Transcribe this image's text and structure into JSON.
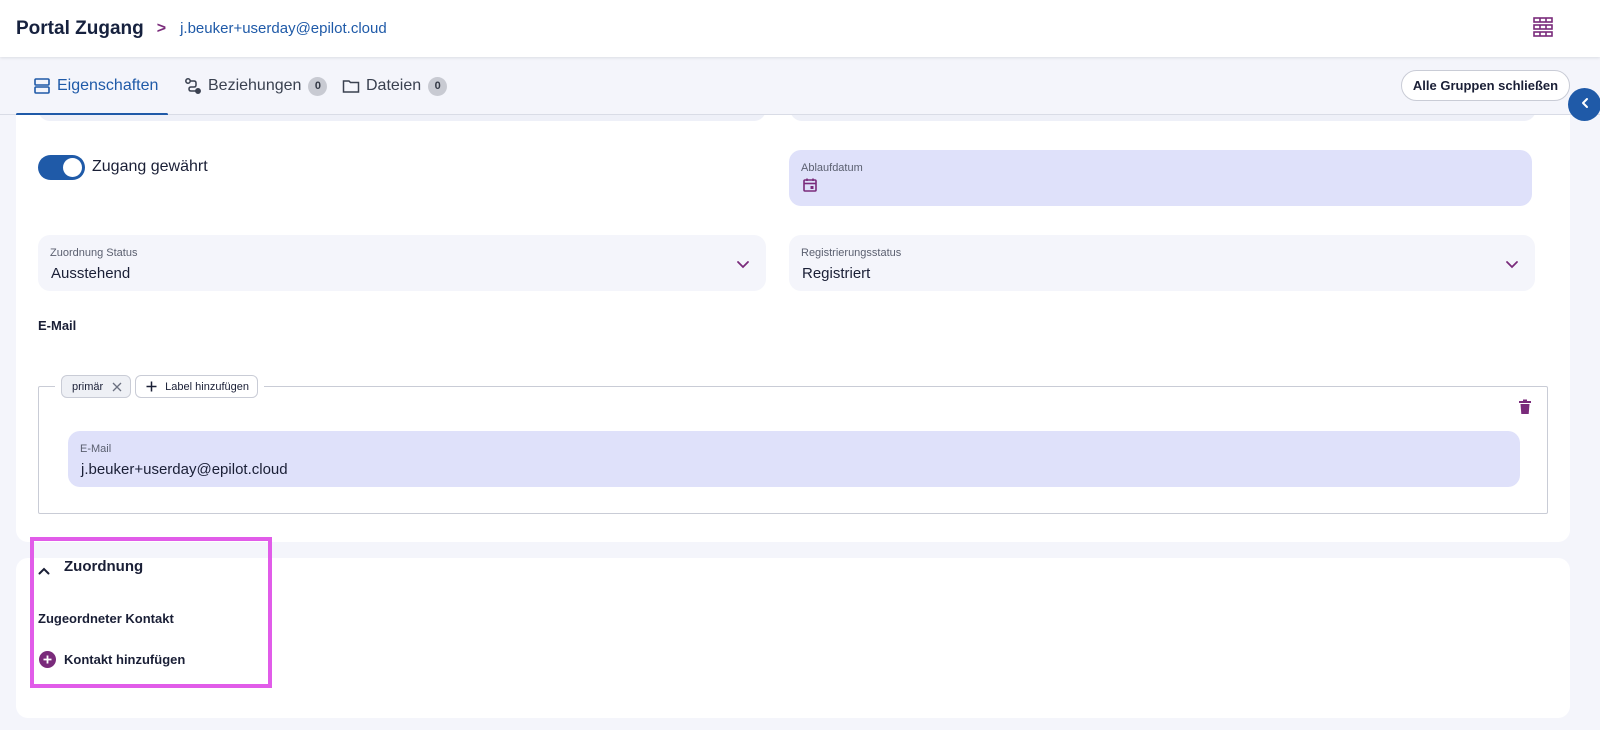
{
  "header": {
    "title": "Portal Zugang",
    "breadcrumb_separator": ">",
    "breadcrumb_email": "j.beuker+userday@epilot.cloud",
    "right_icon": "grid-icon"
  },
  "tabs": [
    {
      "label": "Eigenschaften",
      "icon": "database-icon",
      "active": true
    },
    {
      "label": "Beziehungen",
      "icon": "relations-icon",
      "count": "0"
    },
    {
      "label": "Dateien",
      "icon": "folder-icon",
      "count": "0"
    }
  ],
  "actions": {
    "close_groups": "Alle Gruppen schließen",
    "collapse_icon": "chevron-left-icon"
  },
  "properties": {
    "access_toggle_label": "Zugang gewährt",
    "access_granted": true,
    "expiry": {
      "label": "Ablaufdatum",
      "value": ""
    },
    "assignment_status": {
      "label": "Zuordnung Status",
      "value": "Ausstehend"
    },
    "registration_status": {
      "label": "Registrierungsstatus",
      "value": "Registriert"
    },
    "email_section_title": "E-Mail",
    "email_chip_primary": "primär",
    "add_label_chip": "Label hinzufügen",
    "email_field": {
      "label": "E-Mail",
      "value": "j.beuker+userday@epilot.cloud"
    }
  },
  "assignment": {
    "group_title": "Zuordnung",
    "assigned_contact_title": "Zugeordneter Kontakt",
    "add_contact": "Kontakt hinzufügen"
  },
  "colors": {
    "primary": "#1f5aa8",
    "accent": "#7a2b7b",
    "field_bg": "#dfe1fa",
    "highlight": "#e15ce9"
  }
}
